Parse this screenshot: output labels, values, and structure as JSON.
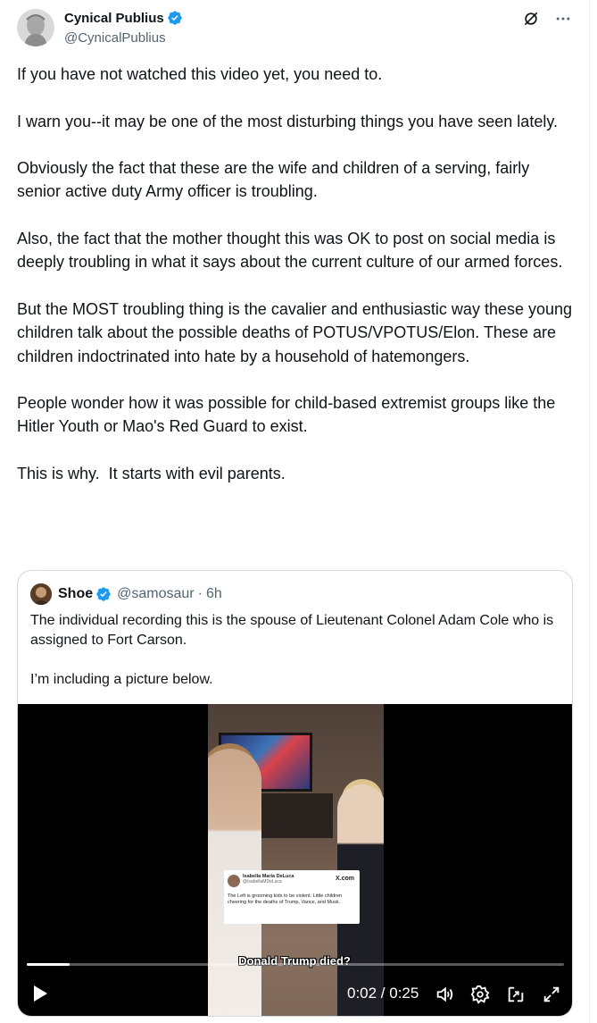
{
  "post": {
    "display_name": "Cynical Publius",
    "handle": "@CynicalPublius",
    "paragraphs": [
      "If you have not watched this video yet, you need to.",
      "I warn you--it may be one of the most disturbing things you have seen lately.",
      "Obviously the fact that these are the wife and children of a serving, fairly senior active duty Army officer is troubling.",
      "Also, the fact that the mother thought this was OK to post on social media is deeply troubling in what it says about the current culture of our armed forces.",
      "But the MOST troubling thing is the cavalier and enthusiastic way these young children talk about the possible deaths of POTUS/VPOTUS/Elon. These are children indoctrinated into hate by a household of hatemongers.",
      "People wonder how it was possible for child-based extremist groups like the Hitler Youth or Mao's Red Guard to exist.",
      "This is why.  It starts with evil parents."
    ]
  },
  "quote": {
    "display_name": "Shoe",
    "handle": "@samosaur",
    "separator": "·",
    "time": "6h",
    "paragraphs": [
      "The individual recording this is the spouse of Lieutenant Colonel Adam Cole who is assigned to Fort Carson.",
      "I’m including a picture below."
    ]
  },
  "video": {
    "embedded_card": {
      "name": "Isabella Maria DeLuca",
      "handle": "@IsabellaMDeLuca",
      "brand": "X.com",
      "text": "The Left is grooming kids to be violent. Little children cheering for the deaths of Trump, Vance, and Musk."
    },
    "subtitle": "Donald Trump died?",
    "time_display": "0:02 / 0:25",
    "progress_fraction": 0.08
  },
  "colors": {
    "verified_blue": "#1d9bf0",
    "text_primary": "#0f1419",
    "text_secondary": "#536471",
    "border": "#cfd9de"
  },
  "icons": [
    "verified-badge-icon",
    "grok-icon",
    "more-icon",
    "play-icon",
    "volume-icon",
    "settings-icon",
    "pip-icon",
    "fullscreen-icon"
  ]
}
